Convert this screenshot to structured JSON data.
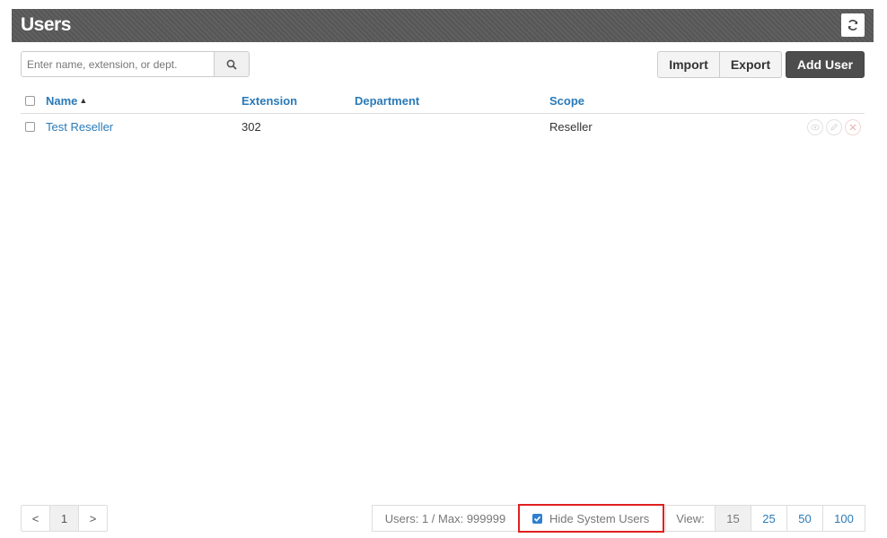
{
  "header": {
    "title": "Users"
  },
  "search": {
    "placeholder": "Enter name, extension, or dept."
  },
  "toolbar": {
    "import_label": "Import",
    "export_label": "Export",
    "add_user_label": "Add User"
  },
  "table": {
    "columns": {
      "name": "Name",
      "sort_indicator": "▲",
      "extension": "Extension",
      "department": "Department",
      "scope": "Scope"
    },
    "rows": [
      {
        "name": "Test Reseller",
        "extension": "302",
        "department": "",
        "scope": "Reseller"
      }
    ]
  },
  "pagination": {
    "prev": "<",
    "current": "1",
    "next": ">"
  },
  "footer": {
    "count_text": "Users: 1 / Max: 999999",
    "hide_system_label": "Hide System Users",
    "view_label": "View:",
    "view_options": [
      "15",
      "25",
      "50",
      "100"
    ],
    "view_selected": "15"
  },
  "colors": {
    "accent": "#2a7ab8",
    "header_bg": "#5a5a5a",
    "highlight": "#e02020"
  }
}
